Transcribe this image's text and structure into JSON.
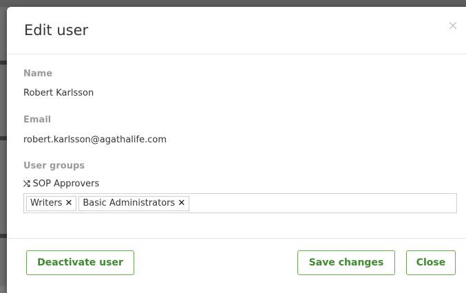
{
  "modal": {
    "title": "Edit user",
    "close_symbol": "×"
  },
  "fields": {
    "name_label": "Name",
    "name_value": "Robert Karlsson",
    "email_label": "Email",
    "email_value": "robert.karlsson@agathalife.com",
    "groups_label": "User groups"
  },
  "groups": {
    "dropdown_item": "SOP Approvers",
    "dropdown_icon": "shuffle-icon",
    "tags": [
      "Writers",
      "Basic Administrators"
    ],
    "tag_remove_symbol": "✕"
  },
  "footer": {
    "deactivate_label": "Deactivate user",
    "save_label": "Save changes",
    "close_label": "Close"
  },
  "colors": {
    "accent_green": "#3d8b2e",
    "border_green": "#6aa84f",
    "label_gray": "#9a9a9a"
  }
}
